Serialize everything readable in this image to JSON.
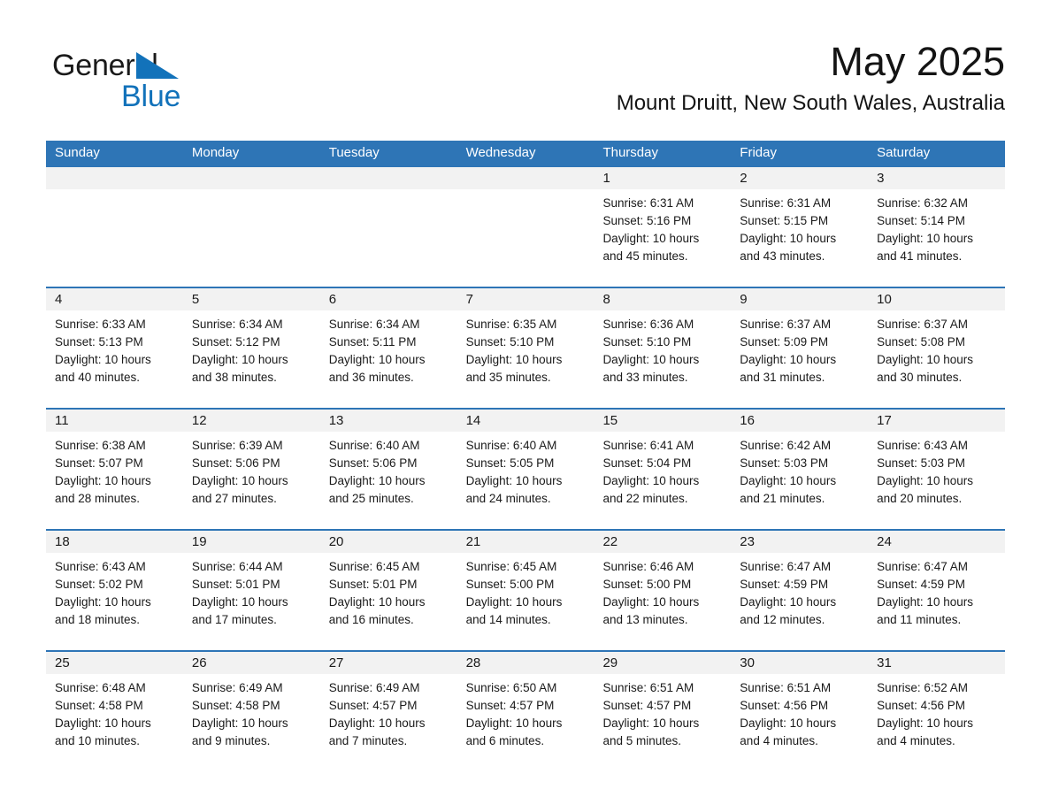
{
  "brand": {
    "name_part1": "General",
    "name_part2": "Blue",
    "triangle_color": "#1272BA"
  },
  "header": {
    "title": "May 2025",
    "subtitle": "Mount Druitt, New South Wales, Australia"
  },
  "theme": {
    "header_blue": "#2E75B6",
    "daynum_band": "#F2F2F2",
    "text_color": "#1a1a1a",
    "page_background": "#ffffff"
  },
  "weekdays": [
    "Sunday",
    "Monday",
    "Tuesday",
    "Wednesday",
    "Thursday",
    "Friday",
    "Saturday"
  ],
  "calendar": {
    "month": "May",
    "year": "2025",
    "weeks": [
      [
        {
          "day": "",
          "sunrise": "",
          "sunset": "",
          "daylight_line1": "",
          "daylight_line2": ""
        },
        {
          "day": "",
          "sunrise": "",
          "sunset": "",
          "daylight_line1": "",
          "daylight_line2": ""
        },
        {
          "day": "",
          "sunrise": "",
          "sunset": "",
          "daylight_line1": "",
          "daylight_line2": ""
        },
        {
          "day": "",
          "sunrise": "",
          "sunset": "",
          "daylight_line1": "",
          "daylight_line2": ""
        },
        {
          "day": "1",
          "sunrise": "Sunrise: 6:31 AM",
          "sunset": "Sunset: 5:16 PM",
          "daylight_line1": "Daylight: 10 hours",
          "daylight_line2": "and 45 minutes."
        },
        {
          "day": "2",
          "sunrise": "Sunrise: 6:31 AM",
          "sunset": "Sunset: 5:15 PM",
          "daylight_line1": "Daylight: 10 hours",
          "daylight_line2": "and 43 minutes."
        },
        {
          "day": "3",
          "sunrise": "Sunrise: 6:32 AM",
          "sunset": "Sunset: 5:14 PM",
          "daylight_line1": "Daylight: 10 hours",
          "daylight_line2": "and 41 minutes."
        }
      ],
      [
        {
          "day": "4",
          "sunrise": "Sunrise: 6:33 AM",
          "sunset": "Sunset: 5:13 PM",
          "daylight_line1": "Daylight: 10 hours",
          "daylight_line2": "and 40 minutes."
        },
        {
          "day": "5",
          "sunrise": "Sunrise: 6:34 AM",
          "sunset": "Sunset: 5:12 PM",
          "daylight_line1": "Daylight: 10 hours",
          "daylight_line2": "and 38 minutes."
        },
        {
          "day": "6",
          "sunrise": "Sunrise: 6:34 AM",
          "sunset": "Sunset: 5:11 PM",
          "daylight_line1": "Daylight: 10 hours",
          "daylight_line2": "and 36 minutes."
        },
        {
          "day": "7",
          "sunrise": "Sunrise: 6:35 AM",
          "sunset": "Sunset: 5:10 PM",
          "daylight_line1": "Daylight: 10 hours",
          "daylight_line2": "and 35 minutes."
        },
        {
          "day": "8",
          "sunrise": "Sunrise: 6:36 AM",
          "sunset": "Sunset: 5:10 PM",
          "daylight_line1": "Daylight: 10 hours",
          "daylight_line2": "and 33 minutes."
        },
        {
          "day": "9",
          "sunrise": "Sunrise: 6:37 AM",
          "sunset": "Sunset: 5:09 PM",
          "daylight_line1": "Daylight: 10 hours",
          "daylight_line2": "and 31 minutes."
        },
        {
          "day": "10",
          "sunrise": "Sunrise: 6:37 AM",
          "sunset": "Sunset: 5:08 PM",
          "daylight_line1": "Daylight: 10 hours",
          "daylight_line2": "and 30 minutes."
        }
      ],
      [
        {
          "day": "11",
          "sunrise": "Sunrise: 6:38 AM",
          "sunset": "Sunset: 5:07 PM",
          "daylight_line1": "Daylight: 10 hours",
          "daylight_line2": "and 28 minutes."
        },
        {
          "day": "12",
          "sunrise": "Sunrise: 6:39 AM",
          "sunset": "Sunset: 5:06 PM",
          "daylight_line1": "Daylight: 10 hours",
          "daylight_line2": "and 27 minutes."
        },
        {
          "day": "13",
          "sunrise": "Sunrise: 6:40 AM",
          "sunset": "Sunset: 5:06 PM",
          "daylight_line1": "Daylight: 10 hours",
          "daylight_line2": "and 25 minutes."
        },
        {
          "day": "14",
          "sunrise": "Sunrise: 6:40 AM",
          "sunset": "Sunset: 5:05 PM",
          "daylight_line1": "Daylight: 10 hours",
          "daylight_line2": "and 24 minutes."
        },
        {
          "day": "15",
          "sunrise": "Sunrise: 6:41 AM",
          "sunset": "Sunset: 5:04 PM",
          "daylight_line1": "Daylight: 10 hours",
          "daylight_line2": "and 22 minutes."
        },
        {
          "day": "16",
          "sunrise": "Sunrise: 6:42 AM",
          "sunset": "Sunset: 5:03 PM",
          "daylight_line1": "Daylight: 10 hours",
          "daylight_line2": "and 21 minutes."
        },
        {
          "day": "17",
          "sunrise": "Sunrise: 6:43 AM",
          "sunset": "Sunset: 5:03 PM",
          "daylight_line1": "Daylight: 10 hours",
          "daylight_line2": "and 20 minutes."
        }
      ],
      [
        {
          "day": "18",
          "sunrise": "Sunrise: 6:43 AM",
          "sunset": "Sunset: 5:02 PM",
          "daylight_line1": "Daylight: 10 hours",
          "daylight_line2": "and 18 minutes."
        },
        {
          "day": "19",
          "sunrise": "Sunrise: 6:44 AM",
          "sunset": "Sunset: 5:01 PM",
          "daylight_line1": "Daylight: 10 hours",
          "daylight_line2": "and 17 minutes."
        },
        {
          "day": "20",
          "sunrise": "Sunrise: 6:45 AM",
          "sunset": "Sunset: 5:01 PM",
          "daylight_line1": "Daylight: 10 hours",
          "daylight_line2": "and 16 minutes."
        },
        {
          "day": "21",
          "sunrise": "Sunrise: 6:45 AM",
          "sunset": "Sunset: 5:00 PM",
          "daylight_line1": "Daylight: 10 hours",
          "daylight_line2": "and 14 minutes."
        },
        {
          "day": "22",
          "sunrise": "Sunrise: 6:46 AM",
          "sunset": "Sunset: 5:00 PM",
          "daylight_line1": "Daylight: 10 hours",
          "daylight_line2": "and 13 minutes."
        },
        {
          "day": "23",
          "sunrise": "Sunrise: 6:47 AM",
          "sunset": "Sunset: 4:59 PM",
          "daylight_line1": "Daylight: 10 hours",
          "daylight_line2": "and 12 minutes."
        },
        {
          "day": "24",
          "sunrise": "Sunrise: 6:47 AM",
          "sunset": "Sunset: 4:59 PM",
          "daylight_line1": "Daylight: 10 hours",
          "daylight_line2": "and 11 minutes."
        }
      ],
      [
        {
          "day": "25",
          "sunrise": "Sunrise: 6:48 AM",
          "sunset": "Sunset: 4:58 PM",
          "daylight_line1": "Daylight: 10 hours",
          "daylight_line2": "and 10 minutes."
        },
        {
          "day": "26",
          "sunrise": "Sunrise: 6:49 AM",
          "sunset": "Sunset: 4:58 PM",
          "daylight_line1": "Daylight: 10 hours",
          "daylight_line2": "and 9 minutes."
        },
        {
          "day": "27",
          "sunrise": "Sunrise: 6:49 AM",
          "sunset": "Sunset: 4:57 PM",
          "daylight_line1": "Daylight: 10 hours",
          "daylight_line2": "and 7 minutes."
        },
        {
          "day": "28",
          "sunrise": "Sunrise: 6:50 AM",
          "sunset": "Sunset: 4:57 PM",
          "daylight_line1": "Daylight: 10 hours",
          "daylight_line2": "and 6 minutes."
        },
        {
          "day": "29",
          "sunrise": "Sunrise: 6:51 AM",
          "sunset": "Sunset: 4:57 PM",
          "daylight_line1": "Daylight: 10 hours",
          "daylight_line2": "and 5 minutes."
        },
        {
          "day": "30",
          "sunrise": "Sunrise: 6:51 AM",
          "sunset": "Sunset: 4:56 PM",
          "daylight_line1": "Daylight: 10 hours",
          "daylight_line2": "and 4 minutes."
        },
        {
          "day": "31",
          "sunrise": "Sunrise: 6:52 AM",
          "sunset": "Sunset: 4:56 PM",
          "daylight_line1": "Daylight: 10 hours",
          "daylight_line2": "and 4 minutes."
        }
      ]
    ]
  }
}
